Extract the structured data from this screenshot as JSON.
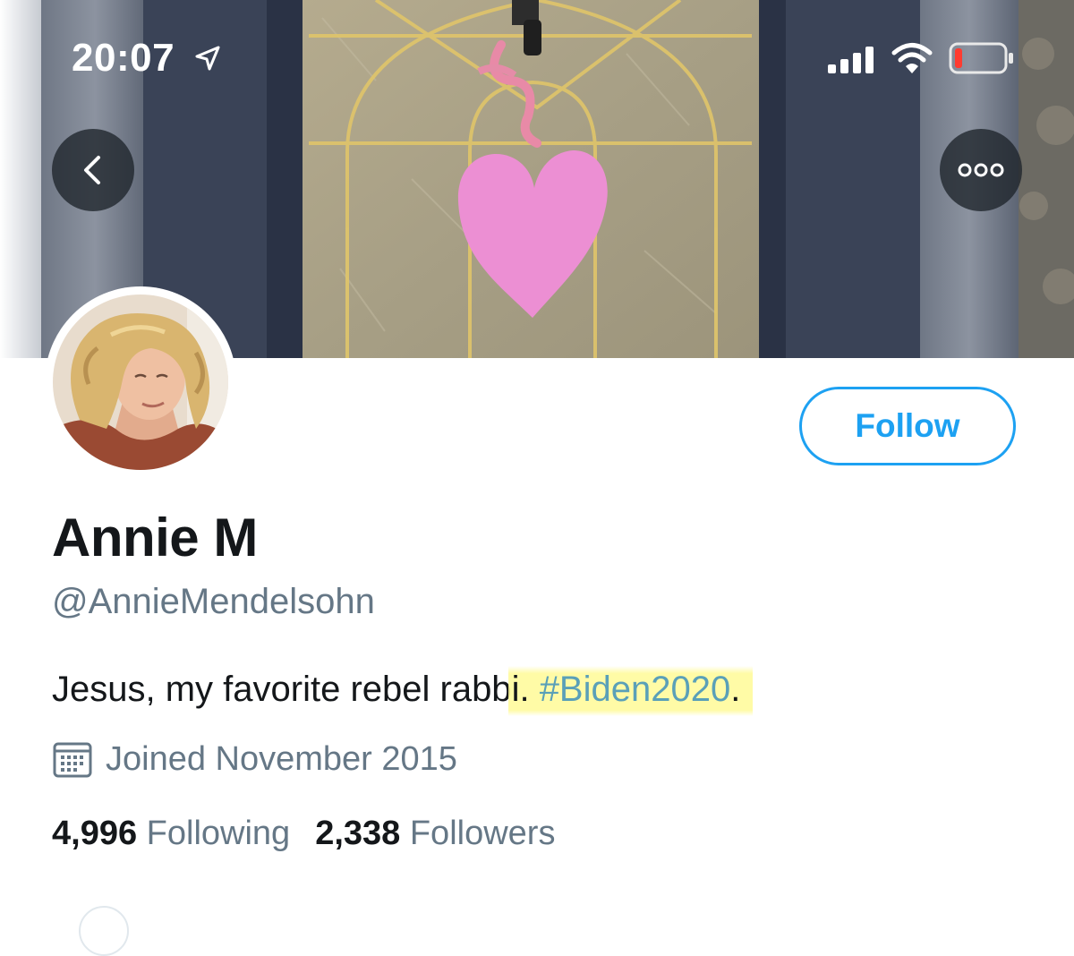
{
  "status_bar": {
    "time": "20:07",
    "location_icon": "location-arrow-icon",
    "signal_icon": "cellular-signal-icon",
    "wifi_icon": "wifi-icon",
    "battery_icon": "battery-low-icon",
    "battery_color": "#ff3b30"
  },
  "nav": {
    "back_icon": "chevron-left-icon",
    "more_icon": "more-dots-icon"
  },
  "profile": {
    "display_name": "Annie M",
    "handle": "@AnnieMendelsohn",
    "bio_before": "Jesus, my favorite rebel rabb",
    "bio_highlight_lead": "i. ",
    "bio_hashtag": "#Biden2020",
    "bio_after": ".",
    "joined": "Joined November 2015",
    "calendar_icon": "calendar-icon"
  },
  "follow_button": {
    "label": "Follow",
    "color": "#1da1f2"
  },
  "stats": {
    "following_count": "4,996",
    "following_label": "Following",
    "followers_count": "2,338",
    "followers_label": "Followers"
  },
  "colors": {
    "text_primary": "#14171a",
    "text_secondary": "#657786",
    "accent": "#1da1f2",
    "highlight": "#fffa96"
  }
}
